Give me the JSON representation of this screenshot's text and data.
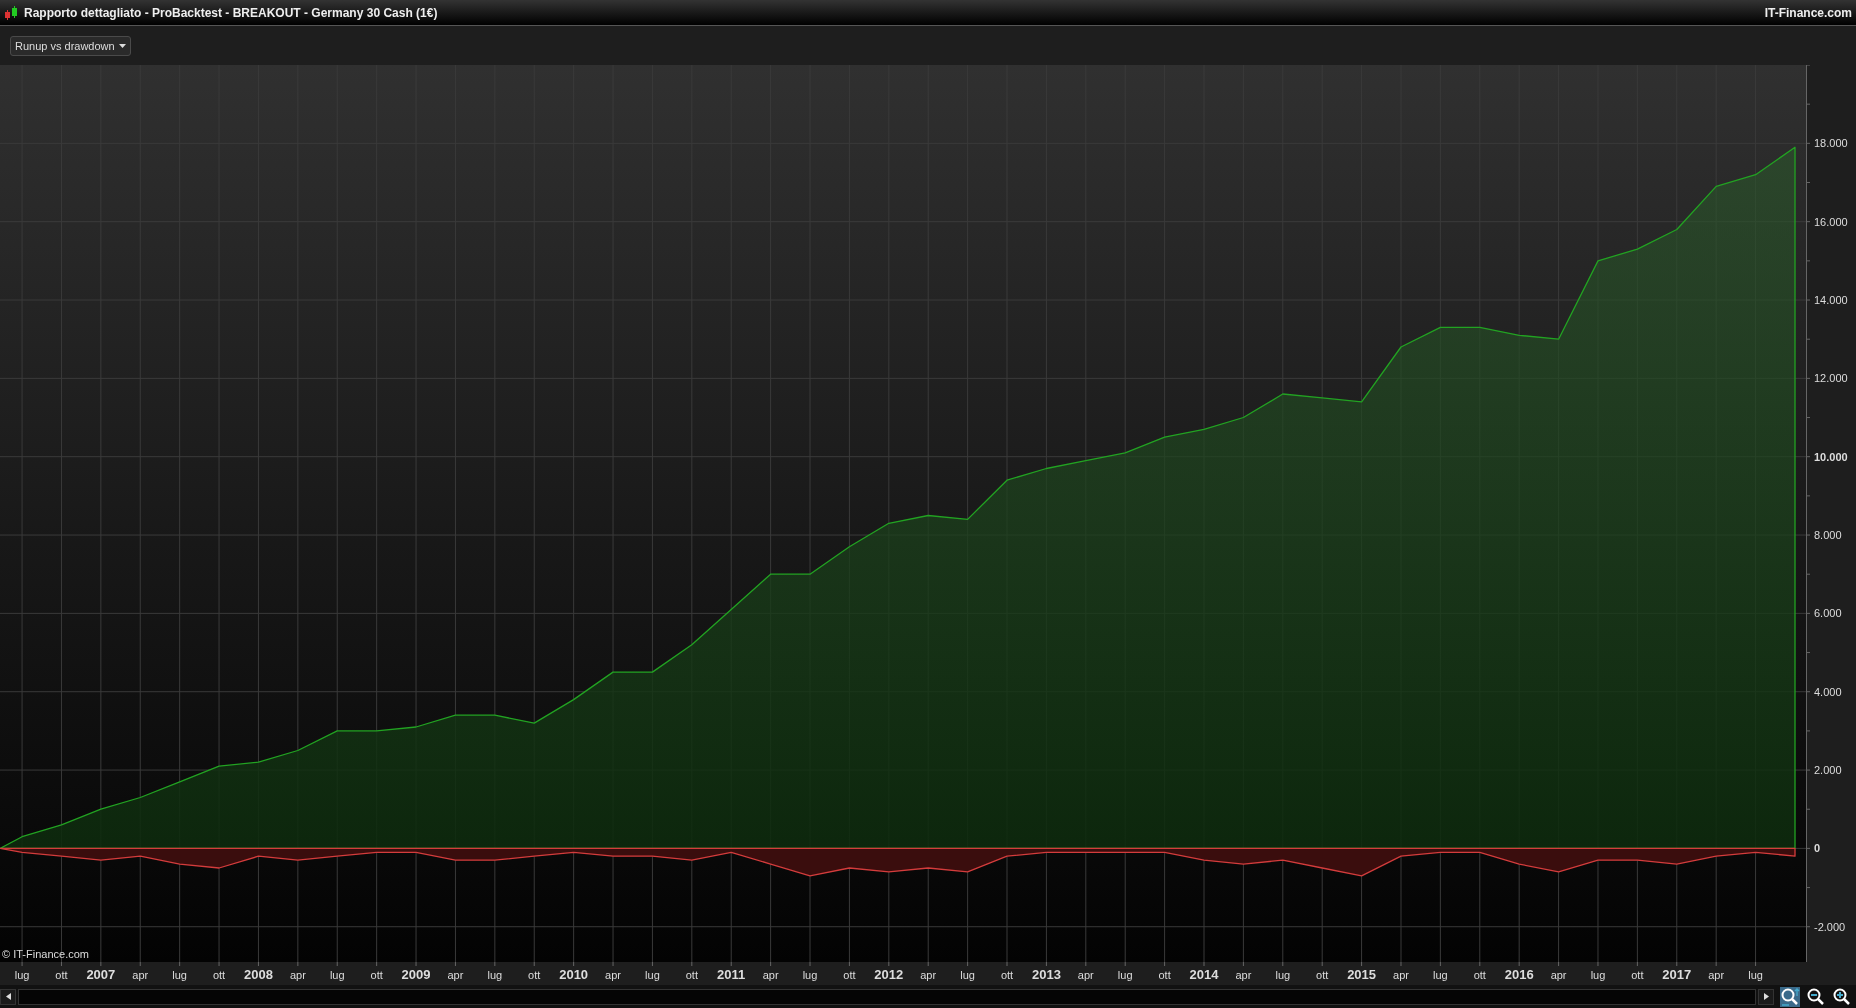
{
  "window": {
    "title": "Rapporto dettagliato - ProBacktest - BREAKOUT - Germany 30 Cash (1€)",
    "brand": "IT-Finance.com"
  },
  "toolbar": {
    "dropdown": "Runup vs drawdown"
  },
  "chart": {
    "watermark": "© IT-Finance.com",
    "chart_data": {
      "type": "area",
      "x": [
        2006.36,
        2006.5,
        2006.75,
        2007,
        2007.25,
        2007.5,
        2007.75,
        2008,
        2008.25,
        2008.5,
        2008.75,
        2009,
        2009.25,
        2009.5,
        2009.75,
        2010,
        2010.25,
        2010.5,
        2010.75,
        2011,
        2011.25,
        2011.5,
        2011.75,
        2012,
        2012.25,
        2012.5,
        2012.75,
        2013,
        2013.25,
        2013.5,
        2013.75,
        2014,
        2014.25,
        2014.5,
        2014.75,
        2015,
        2015.25,
        2015.5,
        2015.75,
        2016,
        2016.25,
        2016.5,
        2016.75,
        2017,
        2017.25,
        2017.5,
        2017.75
      ],
      "series": [
        {
          "color": "#22a322",
          "values": [
            0,
            300,
            600,
            1000,
            1300,
            1700,
            2100,
            2200,
            2500,
            3000,
            3000,
            3100,
            3400,
            3400,
            3200,
            3800,
            4500,
            4500,
            5200,
            6100,
            7000,
            7000,
            7700,
            8300,
            8500,
            8400,
            9400,
            9700,
            9900,
            10100,
            10500,
            10700,
            11000,
            11600,
            11500,
            11400,
            12800,
            13300,
            13300,
            13100,
            13000,
            15000,
            15300,
            15800,
            16900,
            17200,
            17900
          ]
        },
        {
          "color": "#d43c3c",
          "values": [
            0,
            -100,
            -200,
            -300,
            -200,
            -400,
            -500,
            -200,
            -300,
            -200,
            -100,
            -100,
            -300,
            -300,
            -200,
            -100,
            -200,
            -200,
            -300,
            -100,
            -400,
            -700,
            -500,
            -600,
            -500,
            -600,
            -200,
            -100,
            -100,
            -100,
            -100,
            -300,
            -400,
            -300,
            -500,
            -700,
            -200,
            -100,
            -100,
            -400,
            -600,
            -300,
            -300,
            -400,
            -200,
            -100,
            -200
          ]
        }
      ],
      "grid": true,
      "xlim": [
        2006.36,
        2017.82
      ],
      "ylim": [
        -2900,
        20000
      ],
      "yticks": [
        {
          "value": -2000,
          "label": "-2.000"
        },
        {
          "value": 0,
          "label": "0"
        },
        {
          "value": 2000,
          "label": "2.000"
        },
        {
          "value": 4000,
          "label": "4.000"
        },
        {
          "value": 6000,
          "label": "6.000"
        },
        {
          "value": 8000,
          "label": "8.000"
        },
        {
          "value": 10000,
          "label": "10.000"
        },
        {
          "value": 12000,
          "label": "12.000"
        },
        {
          "value": 14000,
          "label": "14.000"
        },
        {
          "value": 16000,
          "label": "16.000"
        },
        {
          "value": 18000,
          "label": "18.000"
        }
      ],
      "xticks": [
        {
          "value": 2006.5,
          "label": "lug"
        },
        {
          "value": 2006.75,
          "label": "ott"
        },
        {
          "value": 2007,
          "label": "2007"
        },
        {
          "value": 2007.25,
          "label": "apr"
        },
        {
          "value": 2007.5,
          "label": "lug"
        },
        {
          "value": 2007.75,
          "label": "ott"
        },
        {
          "value": 2008,
          "label": "2008"
        },
        {
          "value": 2008.25,
          "label": "apr"
        },
        {
          "value": 2008.5,
          "label": "lug"
        },
        {
          "value": 2008.75,
          "label": "ott"
        },
        {
          "value": 2009,
          "label": "2009"
        },
        {
          "value": 2009.25,
          "label": "apr"
        },
        {
          "value": 2009.5,
          "label": "lug"
        },
        {
          "value": 2009.75,
          "label": "ott"
        },
        {
          "value": 2010,
          "label": "2010"
        },
        {
          "value": 2010.25,
          "label": "apr"
        },
        {
          "value": 2010.5,
          "label": "lug"
        },
        {
          "value": 2010.75,
          "label": "ott"
        },
        {
          "value": 2011,
          "label": "2011"
        },
        {
          "value": 2011.25,
          "label": "apr"
        },
        {
          "value": 2011.5,
          "label": "lug"
        },
        {
          "value": 2011.75,
          "label": "ott"
        },
        {
          "value": 2012,
          "label": "2012"
        },
        {
          "value": 2012.25,
          "label": "apr"
        },
        {
          "value": 2012.5,
          "label": "lug"
        },
        {
          "value": 2012.75,
          "label": "ott"
        },
        {
          "value": 2013,
          "label": "2013"
        },
        {
          "value": 2013.25,
          "label": "apr"
        },
        {
          "value": 2013.5,
          "label": "lug"
        },
        {
          "value": 2013.75,
          "label": "ott"
        },
        {
          "value": 2014,
          "label": "2014"
        },
        {
          "value": 2014.25,
          "label": "apr"
        },
        {
          "value": 2014.5,
          "label": "lug"
        },
        {
          "value": 2014.75,
          "label": "ott"
        },
        {
          "value": 2015,
          "label": "2015"
        },
        {
          "value": 2015.25,
          "label": "apr"
        },
        {
          "value": 2015.5,
          "label": "lug"
        },
        {
          "value": 2015.75,
          "label": "ott"
        },
        {
          "value": 2016,
          "label": "2016"
        },
        {
          "value": 2016.25,
          "label": "apr"
        },
        {
          "value": 2016.5,
          "label": "lug"
        },
        {
          "value": 2016.75,
          "label": "ott"
        },
        {
          "value": 2017,
          "label": "2017"
        },
        {
          "value": 2017.25,
          "label": "apr"
        },
        {
          "value": 2017.5,
          "label": "lug"
        }
      ]
    }
  }
}
